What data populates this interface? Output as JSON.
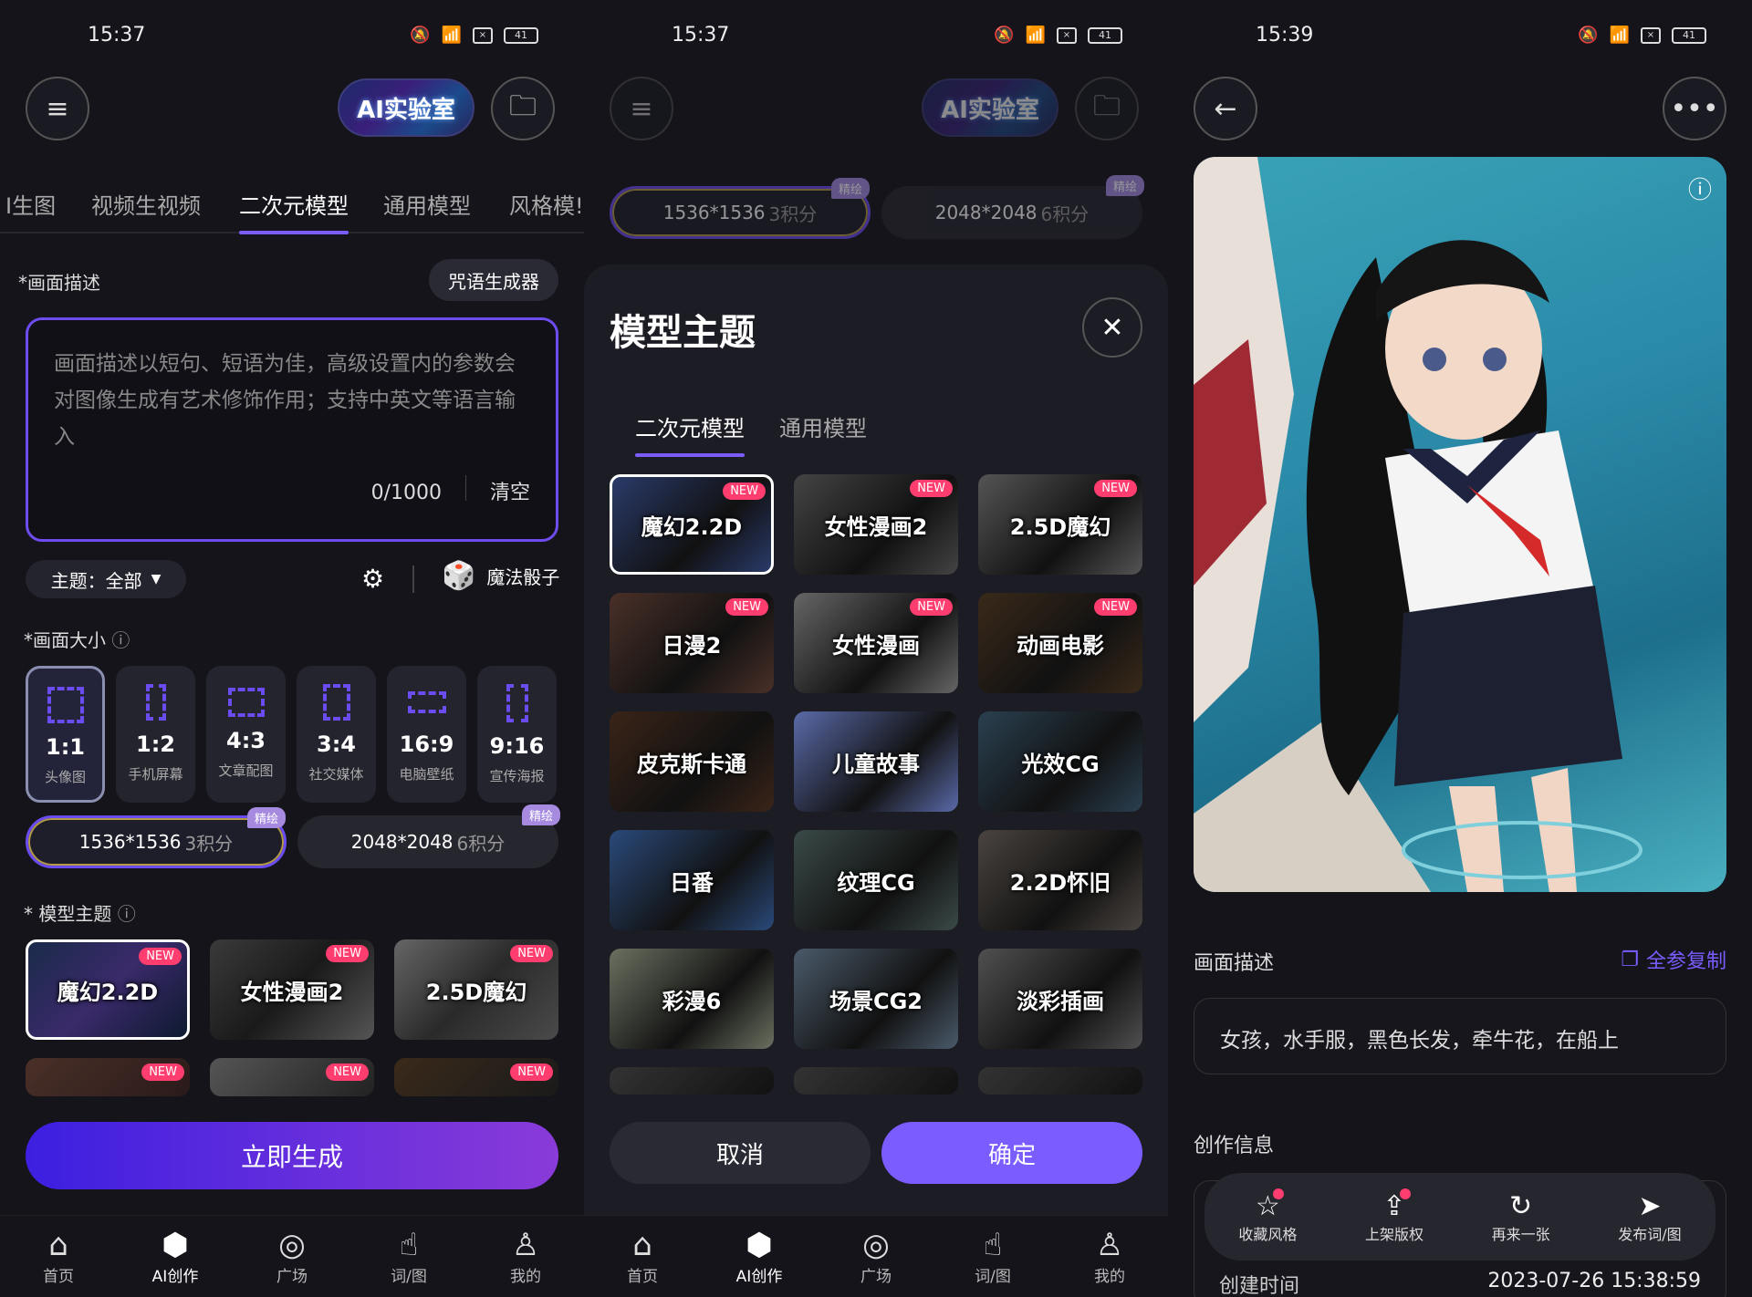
{
  "panel1": {
    "status": {
      "time": "15:37",
      "battery": "41"
    },
    "logo": "AI实验室",
    "tabs": [
      "I生图",
      "视频生视频",
      "二次元模型",
      "通用模型",
      "风格模!"
    ],
    "desc_label": "*画面描述",
    "spell_btn": "咒语生成器",
    "placeholder": "画面描述以短句、短语为佳，高级设置内的参数会对图像生成有艺术修饰作用；支持中英文等语言输入",
    "counter": "0/1000",
    "clear": "清空",
    "theme_select": "主题：全部",
    "dice": "魔法骰子",
    "size_label": "*画面大小",
    "sizes": [
      {
        "ratio": "1:1",
        "desc": "头像图"
      },
      {
        "ratio": "1:2",
        "desc": "手机屏幕"
      },
      {
        "ratio": "4:3",
        "desc": "文章配图"
      },
      {
        "ratio": "3:4",
        "desc": "社交媒体"
      },
      {
        "ratio": "16:9",
        "desc": "电脑壁纸"
      },
      {
        "ratio": "9:16",
        "desc": "宣传海报"
      }
    ],
    "res": [
      {
        "main": "1536*1536",
        "sub": "3积分",
        "tag": "精绘"
      },
      {
        "main": "2048*2048",
        "sub": "6积分",
        "tag": "精绘"
      }
    ],
    "model_label": "* 模型主题",
    "models": [
      "魔幻2.2D",
      "女性漫画2",
      "2.5D魔幻"
    ],
    "new_badge": "NEW",
    "generate": "立即生成"
  },
  "panel2": {
    "status": {
      "time": "15:37",
      "battery": "41"
    },
    "logo": "AI实验室",
    "sheet_title": "模型主题",
    "tabs": [
      "二次元模型",
      "通用模型"
    ],
    "res": [
      {
        "main": "1536*1536",
        "sub": "3积分",
        "tag": "精绘"
      },
      {
        "main": "2048*2048",
        "sub": "6积分",
        "tag": "精绘"
      }
    ],
    "models": [
      {
        "name": "魔幻2.2D",
        "new": true
      },
      {
        "name": "女性漫画2",
        "new": true
      },
      {
        "name": "2.5D魔幻",
        "new": true
      },
      {
        "name": "日漫2",
        "new": true
      },
      {
        "name": "女性漫画",
        "new": true
      },
      {
        "name": "动画电影",
        "new": true
      },
      {
        "name": "皮克斯卡通",
        "new": false
      },
      {
        "name": "儿童故事",
        "new": false
      },
      {
        "name": "光效CG",
        "new": false
      },
      {
        "name": "日番",
        "new": false
      },
      {
        "name": "纹理CG",
        "new": false
      },
      {
        "name": "2.2D怀旧",
        "new": false
      },
      {
        "name": "彩漫6",
        "new": false
      },
      {
        "name": "场景CG2",
        "new": false
      },
      {
        "name": "淡彩插画",
        "new": false
      }
    ],
    "cancel": "取消",
    "confirm": "确定"
  },
  "panel3": {
    "status": {
      "time": "15:39",
      "battery": "41"
    },
    "desc_label": "画面描述",
    "copy_all": "全参复制",
    "prompt": "女孩，水手服，黑色长发，牵牛花，在船上",
    "info_label": "创作信息",
    "actions": [
      "收藏风格",
      "上架版权",
      "再来一张",
      "发布词/图"
    ],
    "created_label": "创建时间",
    "created_value": "2023-07-26 15:38:59"
  },
  "nav": [
    "首页",
    "AI创作",
    "广场",
    "词/图",
    "我的"
  ],
  "colors": {
    "accent": "#7b5cff",
    "bg": "#14141a",
    "new": "#ff3d6e"
  }
}
